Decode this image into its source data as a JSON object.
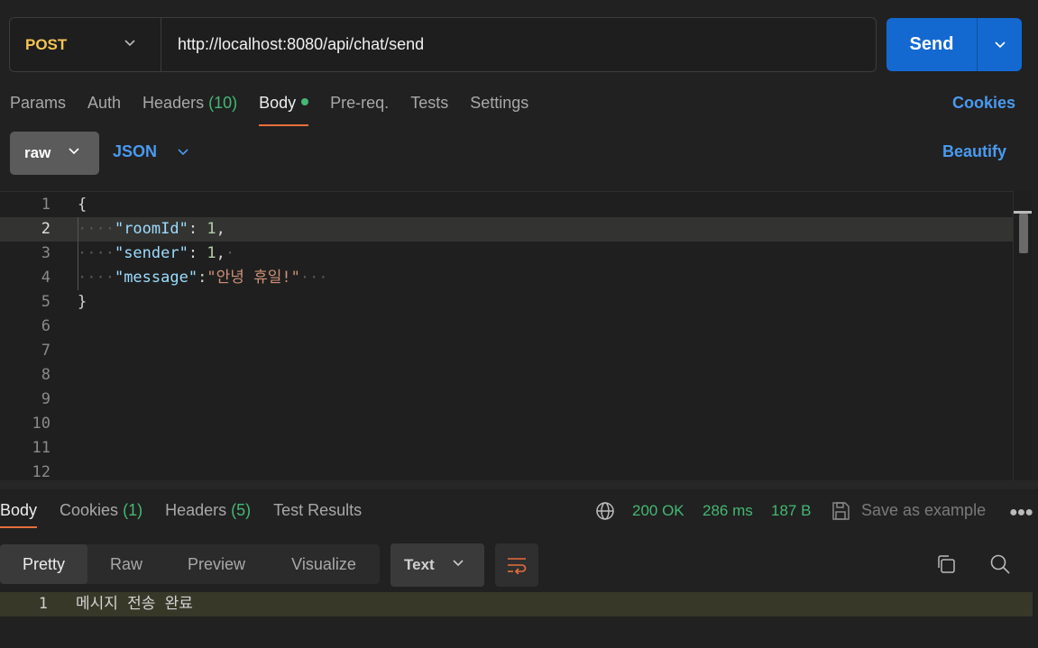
{
  "request": {
    "method": "POST",
    "url": "http://localhost:8080/api/chat/send",
    "send_label": "Send"
  },
  "req_tabs": [
    {
      "label": "Params"
    },
    {
      "label": "Auth"
    },
    {
      "label": "Headers",
      "count": "(10)"
    },
    {
      "label": "Body",
      "active": true
    },
    {
      "label": "Pre-req."
    },
    {
      "label": "Tests"
    },
    {
      "label": "Settings"
    }
  ],
  "cookies_label": "Cookies",
  "body_options": {
    "mode": "raw",
    "language": "JSON",
    "beautify": "Beautify"
  },
  "editor": {
    "line_numbers": [
      "1",
      "2",
      "3",
      "4",
      "5",
      "6",
      "7",
      "8",
      "9",
      "10",
      "11",
      "12"
    ],
    "current_line": "2",
    "lines": {
      "l1": "{",
      "l2_key": "\"roomId\"",
      "l2_sep": ": ",
      "l2_val": "1",
      "l2_end": ",",
      "l3_key": "\"sender\"",
      "l3_sep": ": ",
      "l3_val": "1",
      "l3_end": ",",
      "l4_key": "\"message\"",
      "l4_sep": ":",
      "l4_val": "\"안녕 휴일!\"",
      "l5": "}"
    }
  },
  "response": {
    "tabs": [
      {
        "label": "Body",
        "active": true
      },
      {
        "label": "Cookies",
        "count": "(1)"
      },
      {
        "label": "Headers",
        "count": "(5)"
      },
      {
        "label": "Test Results"
      }
    ],
    "status": "200 OK",
    "time": "286 ms",
    "size": "187 B",
    "save_label": "Save as example",
    "view_modes": [
      "Pretty",
      "Raw",
      "Preview",
      "Visualize"
    ],
    "format": "Text",
    "line_number": "1",
    "body": "메시지 전송 완료"
  },
  "colors": {
    "accent": "#e76f3c",
    "send": "#1469d1",
    "method": "#f5c453",
    "success": "#44b873",
    "link": "#4a9af0"
  },
  "icons": [
    "chevron-down-icon",
    "globe-icon",
    "save-icon",
    "more-icon",
    "wrap-icon",
    "copy-icon",
    "search-icon"
  ]
}
